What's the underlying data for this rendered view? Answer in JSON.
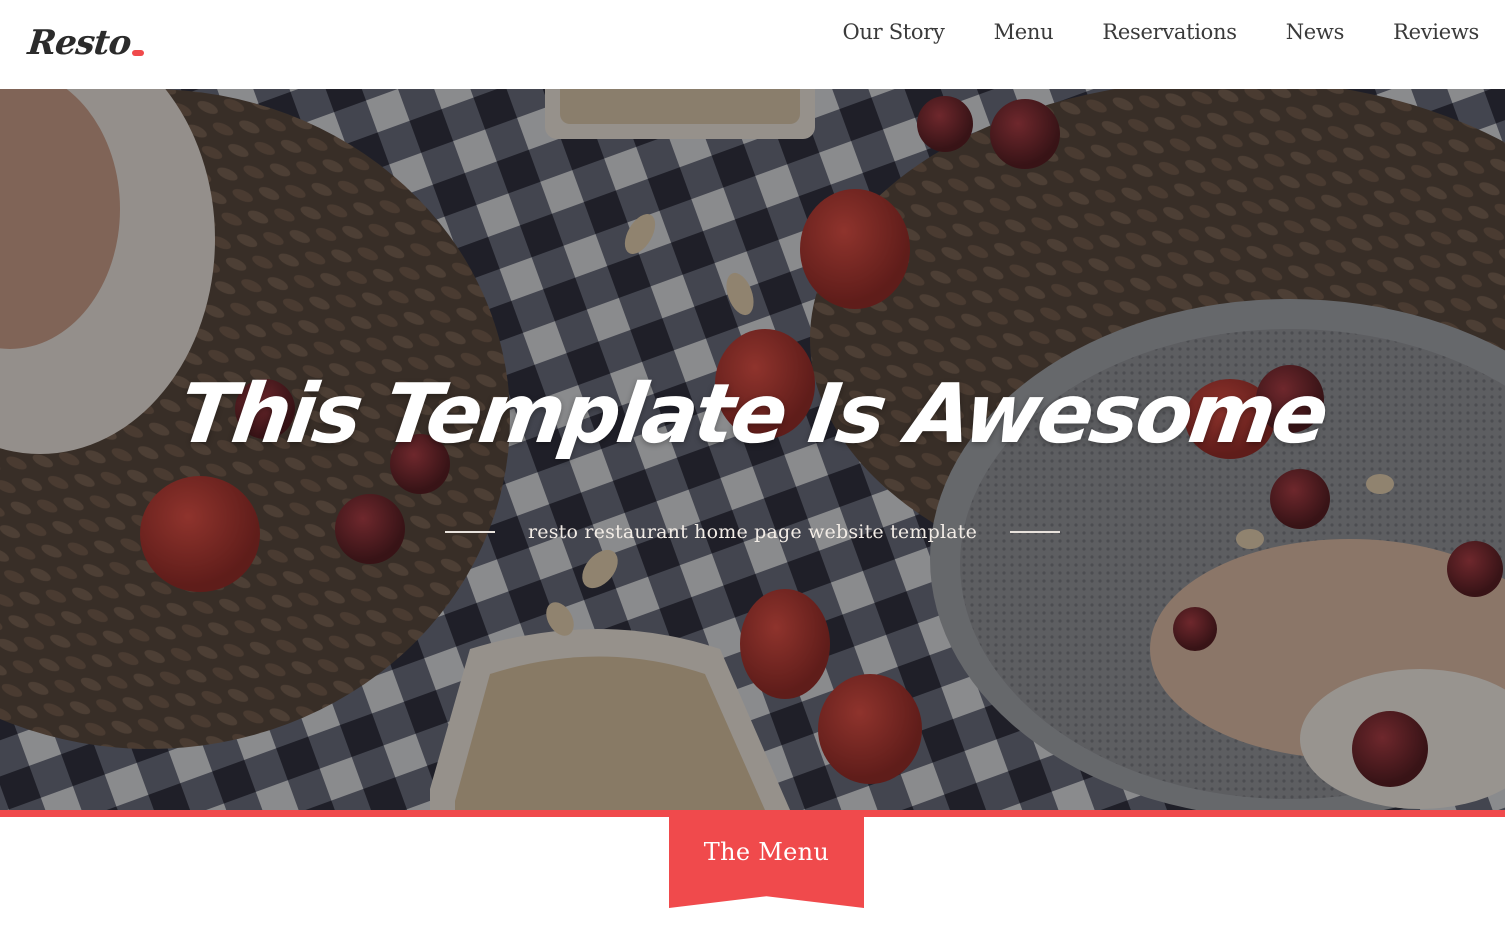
{
  "header": {
    "logo": "Resto",
    "nav": [
      {
        "label": "Our Story"
      },
      {
        "label": "Menu"
      },
      {
        "label": "Reservations"
      },
      {
        "label": "News"
      },
      {
        "label": "Reviews"
      }
    ]
  },
  "hero": {
    "title": "This Template Is Awesome",
    "subtitle": "resto restaurant home page website template"
  },
  "menu_tab": {
    "label": "The Menu"
  },
  "colors": {
    "accent": "#f04a4c",
    "text_dark": "#3a3a3a",
    "hero_text": "#ffffff"
  },
  "icons": [
    "logo-dot"
  ]
}
